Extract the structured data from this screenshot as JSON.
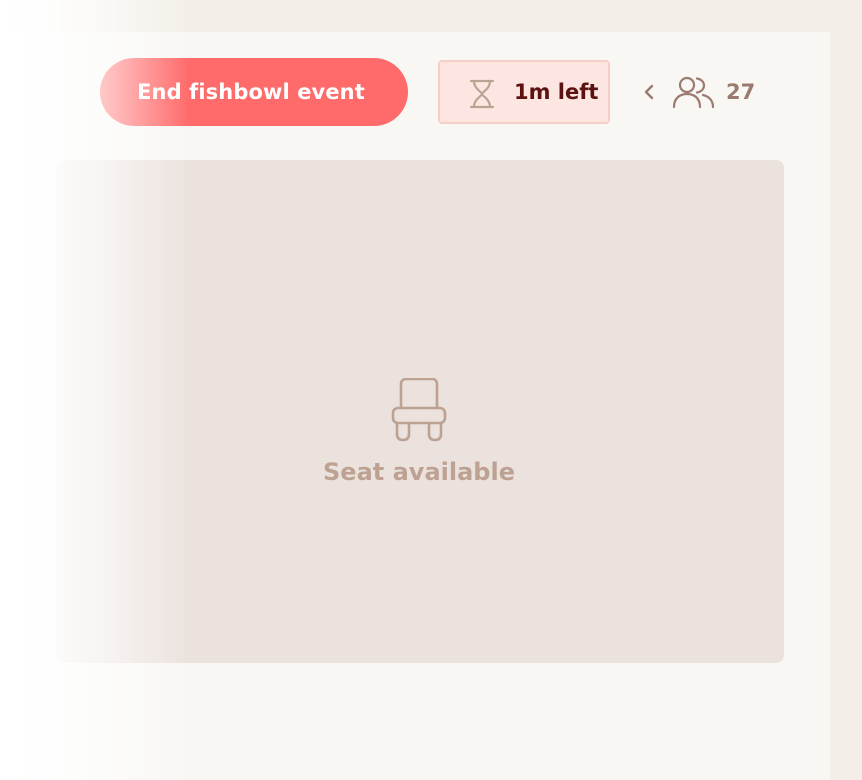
{
  "toolbar": {
    "end_event_label": "End fishbowl event",
    "timer_label": "1m left",
    "timer_icon": "hourglass-icon",
    "collapse_icon": "chevron-left-icon",
    "participants_icon": "users-icon",
    "participants_count": "27"
  },
  "stage": {
    "seat_icon": "chair-icon",
    "seat_label": "Seat available"
  },
  "colors": {
    "accent": "#ff6a6a",
    "timer_bg": "#fde6e1",
    "timer_text": "#5d1212",
    "seat_bg": "#ebe2dd",
    "seat_text": "#bda293",
    "muted_icon": "#9b7b6f"
  }
}
